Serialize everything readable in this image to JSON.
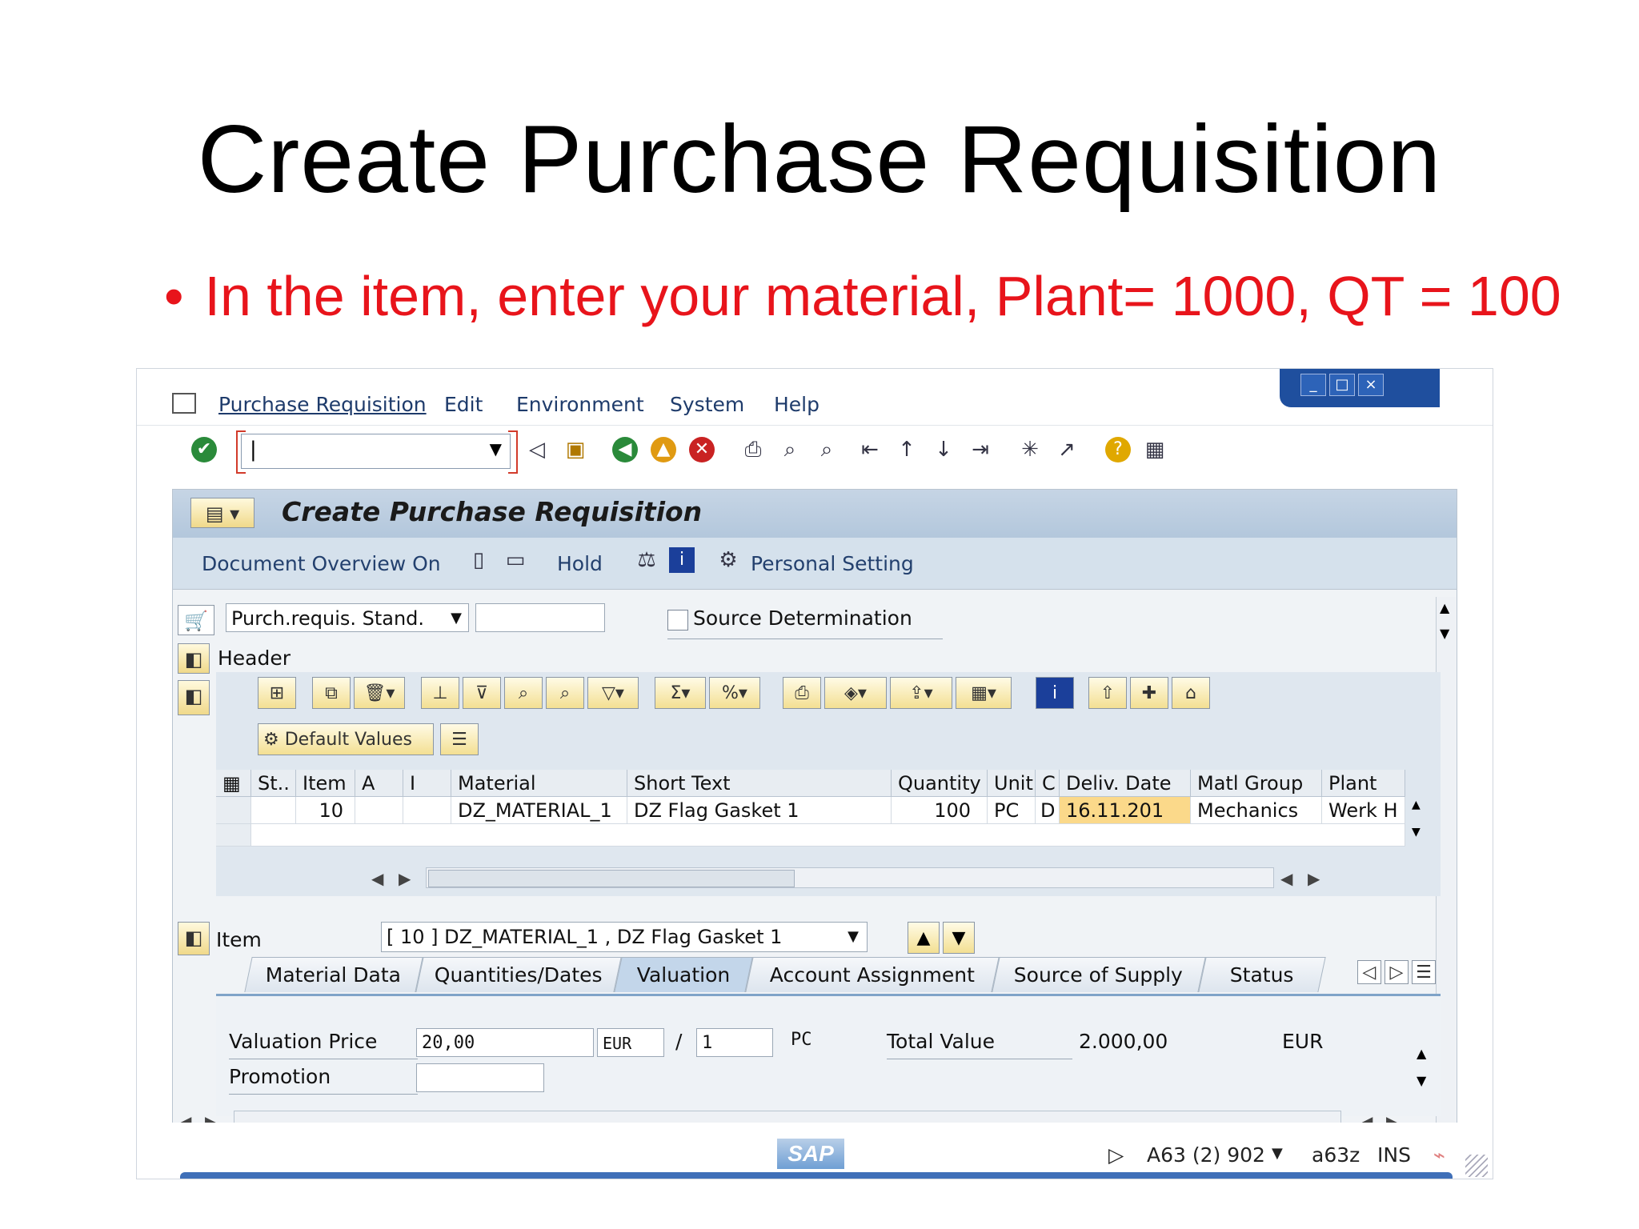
{
  "slide": {
    "title": "Create Purchase Requisition",
    "bullet": "In the item, enter your material, Plant= 1000, QT = 100"
  },
  "menu": [
    "Purchase Requisition",
    "Edit",
    "Environment",
    "System",
    "Help"
  ],
  "window_controls": [
    "_",
    "□",
    "×"
  ],
  "toolbar": {
    "command_value": "|",
    "icons": [
      "check-icon",
      "save-icon",
      "back-icon",
      "exit-icon",
      "cancel-icon",
      "print-icon",
      "find-icon",
      "find-next-icon",
      "first-page-icon",
      "prev-page-icon",
      "next-page-icon",
      "last-page-icon",
      "new-session-icon",
      "shortcut-icon",
      "help-icon",
      "layout-icon"
    ]
  },
  "panel": {
    "title": "Create Purchase Requisition",
    "app_toolbar": {
      "doc_overview": "Document Overview On",
      "hold": "Hold",
      "personal_setting": "Personal Setting"
    }
  },
  "header_area": {
    "doc_type": "Purch.requis. Stand.",
    "doc_number": "",
    "source_determination": "Source Determination",
    "header_label": "Header"
  },
  "grid": {
    "default_values": "Default Values",
    "columns": [
      "St..",
      "Item",
      "A",
      "I",
      "Material",
      "Short Text",
      "Quantity",
      "Unit",
      "C",
      "Deliv. Date",
      "Matl Group",
      "Plant"
    ],
    "rows": [
      [
        "",
        "10",
        "",
        "",
        "DZ_MATERIAL_1",
        "DZ Flag Gasket 1",
        "100",
        "PC",
        "D",
        "16.11.201",
        "Mechanics",
        "Werk H"
      ],
      [
        "",
        "",
        "",
        "",
        "",
        "",
        "",
        "",
        "",
        "",
        "",
        ""
      ]
    ]
  },
  "item_section": {
    "label": "Item",
    "selected": "[ 10 ] DZ_MATERIAL_1 , DZ Flag Gasket 1",
    "tabs": [
      "Material Data",
      "Quantities/Dates",
      "Valuation",
      "Account Assignment",
      "Source of Supply",
      "Status"
    ],
    "active_tab": "Valuation",
    "valuation": {
      "price_label": "Valuation Price",
      "price": "20,00",
      "currency": "EUR",
      "per": "/",
      "per_qty": "1",
      "unit": "PC",
      "total_label": "Total Value",
      "total": "2.000,00",
      "total_currency": "EUR",
      "promotion_label": "Promotion",
      "promotion": ""
    }
  },
  "status_bar": {
    "logo": "SAP",
    "system": "A63 (2) 902",
    "server": "a63z",
    "mode": "INS"
  },
  "colors": {
    "bullet": "#e8141b",
    "panel_header": "#c6d5e5",
    "highlight_cell": "#fbd98a",
    "window_controls": "#1f4f9e"
  }
}
